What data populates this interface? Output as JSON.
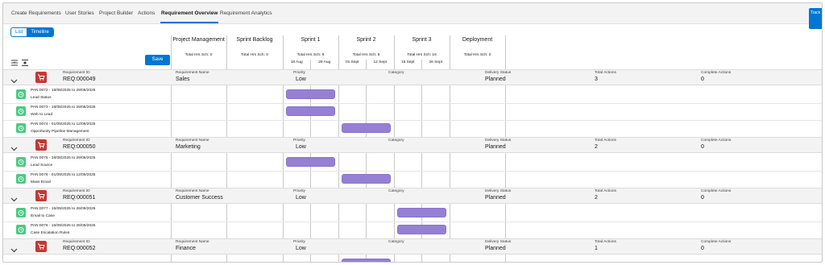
{
  "nav": {
    "tabs": [
      "Create Requirements",
      "User Stories",
      "Project Builder",
      "Actions",
      "Requirement Overview",
      "Requirement Analytics"
    ],
    "active_tab": "Requirement Overview",
    "track_label": "Track"
  },
  "view_toggle": {
    "list": "List",
    "timeline": "Timeline",
    "selected": "Timeline"
  },
  "save_label": "Save",
  "phases": [
    {
      "name": "Project Management",
      "hrs": "Total Hrs Sch: 0",
      "dates": []
    },
    {
      "name": "Sprint Backlog",
      "hrs": "Total Hrs Sch: 0",
      "dates": []
    },
    {
      "name": "Sprint 1",
      "hrs": "Total Hrs Sch: 9",
      "dates": [
        "18 Aug",
        "29 Aug"
      ]
    },
    {
      "name": "Sprint 2",
      "hrs": "Total Hrs Sch: 6",
      "dates": [
        "01 Sept",
        "12 Sept"
      ]
    },
    {
      "name": "Sprint 3",
      "hrs": "Total Hrs Sch: 16",
      "dates": [
        "15 Sept",
        "26 Sept"
      ]
    },
    {
      "name": "Deployment",
      "hrs": "Total Hrs Sch: 0",
      "dates": []
    }
  ],
  "field_labels": {
    "id": "Requirement ID",
    "name": "Requirement Name",
    "priority": "Priority",
    "category": "Category",
    "status": "Delivery Status",
    "total": "Total Actions",
    "complete": "Complete Actions"
  },
  "requirements": [
    {
      "id": "REQ:000049",
      "name": "Sales",
      "priority": "Low",
      "category": "",
      "status": "Planned",
      "total": "3",
      "complete": "0",
      "actions": [
        {
          "line1": "PAN:0072 - 18/08/2025 to 29/08/2025",
          "line2": "Lead Status",
          "sprint": "Sprint 1"
        },
        {
          "line1": "PAN:0073 - 18/08/2025 to 29/08/2025",
          "line2": "Web to Lead",
          "sprint": "Sprint 1"
        },
        {
          "line1": "PAN:0074 - 01/09/2025 to 12/09/2025",
          "line2": "Opportunity Pipeline Management",
          "sprint": "Sprint 2"
        }
      ]
    },
    {
      "id": "REQ:000050",
      "name": "Marketing",
      "priority": "Low",
      "category": "",
      "status": "Planned",
      "total": "2",
      "complete": "0",
      "actions": [
        {
          "line1": "PAN:0075 - 18/08/2025 to 29/08/2025",
          "line2": "Lead Source",
          "sprint": "Sprint 1"
        },
        {
          "line1": "PAN:0076 - 01/09/2025 to 12/09/2025",
          "line2": "Mass Email",
          "sprint": "Sprint 2"
        }
      ]
    },
    {
      "id": "REQ:000051",
      "name": "Customer Success",
      "priority": "Low",
      "category": "",
      "status": "Planned",
      "total": "2",
      "complete": "0",
      "actions": [
        {
          "line1": "PAN:0077 - 15/09/2025 to 26/09/2025",
          "line2": "Email to Case",
          "sprint": "Sprint 3"
        },
        {
          "line1": "PAN:0078 - 15/09/2025 to 26/09/2025",
          "line2": "Case Escalation Rules",
          "sprint": "Sprint 3"
        }
      ]
    },
    {
      "id": "REQ:000052",
      "name": "Finance",
      "priority": "Low",
      "category": "",
      "status": "Planned",
      "total": "1",
      "complete": "0",
      "actions": [
        {
          "line1": "",
          "line2": "",
          "sprint": "Sprint 2"
        }
      ]
    }
  ]
}
